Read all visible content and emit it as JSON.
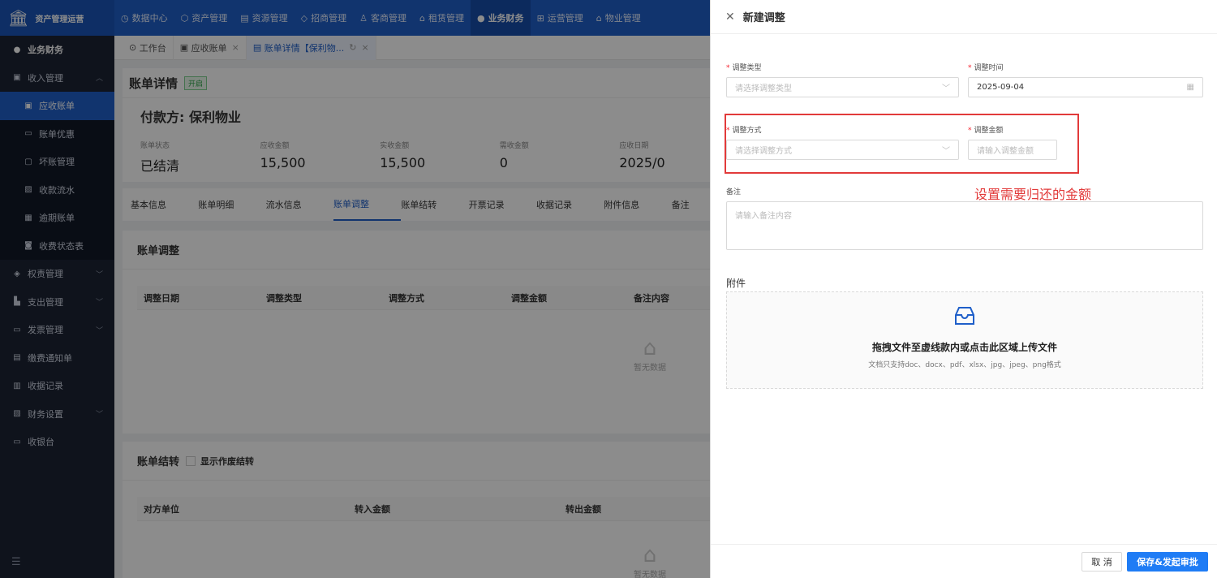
{
  "app": {
    "brand": "资产管理运营",
    "logo_icon": "bank-icon"
  },
  "topnav": [
    {
      "label": "数据中心",
      "icon": "clock-icon",
      "active": false
    },
    {
      "label": "资产管理",
      "icon": "cube-icon",
      "active": false
    },
    {
      "label": "资源管理",
      "icon": "building-icon",
      "active": false
    },
    {
      "label": "招商管理",
      "icon": "diamond-icon",
      "active": false
    },
    {
      "label": "客商管理",
      "icon": "users-icon",
      "active": false
    },
    {
      "label": "租赁管理",
      "icon": "home-icon",
      "active": false
    },
    {
      "label": "业务财务",
      "icon": "dot-icon",
      "active": true
    },
    {
      "label": "运营管理",
      "icon": "grid-icon",
      "active": false
    },
    {
      "label": "物业管理",
      "icon": "house-icon",
      "active": false
    }
  ],
  "sidebar": {
    "items": [
      {
        "label": "业务财务",
        "type": "head"
      },
      {
        "label": "收入管理",
        "type": "group",
        "arrow": "^"
      },
      {
        "label": "应收账单",
        "type": "sub",
        "active": true
      },
      {
        "label": "账单优惠",
        "type": "sub"
      },
      {
        "label": "坏账管理",
        "type": "sub"
      },
      {
        "label": "收款流水",
        "type": "sub"
      },
      {
        "label": "逾期账单",
        "type": "sub"
      },
      {
        "label": "收费状态表",
        "type": "sub"
      },
      {
        "label": "权责管理",
        "type": "group",
        "arrow": "v"
      },
      {
        "label": "支出管理",
        "type": "group",
        "arrow": "v"
      },
      {
        "label": "发票管理",
        "type": "group",
        "arrow": "v"
      },
      {
        "label": "缴费通知单",
        "type": "group"
      },
      {
        "label": "收据记录",
        "type": "group"
      },
      {
        "label": "财务设置",
        "type": "group",
        "arrow": "v"
      },
      {
        "label": "收银台",
        "type": "group"
      }
    ]
  },
  "tabs": [
    {
      "label": "工作台",
      "active": false,
      "closable": false
    },
    {
      "label": "应收账单",
      "active": false,
      "closable": true
    },
    {
      "label": "账单详情【保利物...",
      "active": true,
      "closable": true
    }
  ],
  "page": {
    "title": "账单详情",
    "status_badge": "开启",
    "payer": "付款方: 保利物业",
    "stats": [
      {
        "label": "账单状态",
        "value": "已结清"
      },
      {
        "label": "应收金额",
        "value": "15,500"
      },
      {
        "label": "实收金额",
        "value": "15,500"
      },
      {
        "label": "需收金额",
        "value": "0"
      },
      {
        "label": "应收日期",
        "value": "2025/0"
      }
    ],
    "subtabs": [
      "基本信息",
      "账单明细",
      "流水信息",
      "账单调整",
      "账单结转",
      "开票记录",
      "收据记录",
      "附件信息",
      "备注"
    ],
    "active_subtab": "账单调整",
    "adjust_section": {
      "title": "账单调整",
      "columns": [
        "调整日期",
        "调整类型",
        "调整方式",
        "调整金额",
        "备注内容"
      ],
      "empty_text": "暂无数据"
    },
    "transfer_section": {
      "title": "账单结转",
      "checkbox_label": "显示作废结转",
      "columns": [
        "对方单位",
        "转入金额",
        "转出金额"
      ],
      "empty_text": "暂无数据"
    }
  },
  "drawer": {
    "title": "新建调整",
    "fields": {
      "type": {
        "label": "调整类型",
        "placeholder": "请选择调整类型"
      },
      "time": {
        "label": "调整时间",
        "value": "2025-09-04"
      },
      "method": {
        "label": "调整方式",
        "placeholder": "请选择调整方式"
      },
      "amount": {
        "label": "调整金额",
        "placeholder": "请输入调整金额"
      },
      "remark": {
        "label": "备注",
        "placeholder": "请输入备注内容"
      },
      "attachment": {
        "label": "附件"
      }
    },
    "upload": {
      "main_text": "拖拽文件至虚线款内或点击此区域上传文件",
      "sub_text": "文档只支持doc、docx、pdf、xlsx、jpg、jpeg、png格式"
    },
    "annotation": "设置需要归还的金额",
    "buttons": {
      "cancel": "取 消",
      "save": "保存&发起审批"
    }
  },
  "colors": {
    "primary": "#1f5fc9",
    "sidebar": "#1c2333",
    "highlight": "#e23a3a",
    "required": "#f5222d"
  }
}
